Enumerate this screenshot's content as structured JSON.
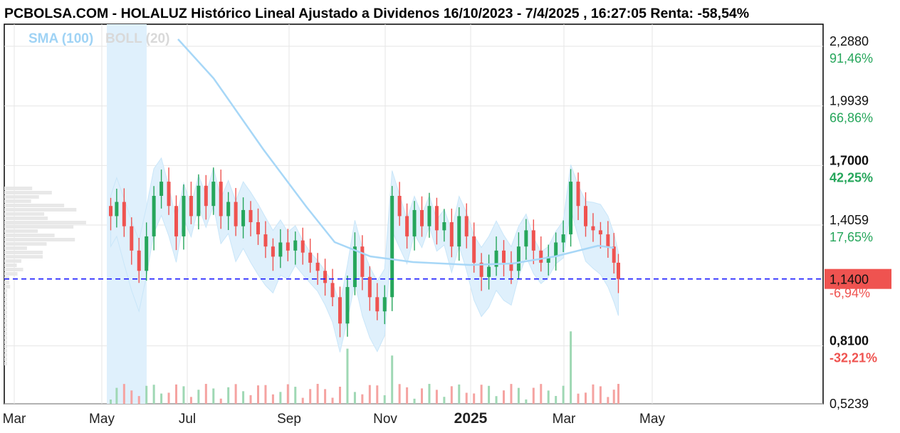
{
  "title": "PCBOLSA.COM - HOLALUZ Histórico Lineal Ajustado a Dividenos 16/10/2023 - 7/4/2025 , 16:27:05 Renta: -58,54%",
  "legend": {
    "sma": "SMA (100)",
    "boll": "BOLL (20)"
  },
  "colors": {
    "up": "#26a65b",
    "down": "#ef5350",
    "sma": "#a7d7f7",
    "band": "#dff0fc",
    "last": "#1a1aff",
    "label_bg": "#ef5350"
  },
  "chart_data": {
    "type": "candlestick",
    "title": "PCBOLSA.COM - HOLALUZ Histórico Lineal Ajustado a Dividenos 16/10/2023 - 7/4/2025 , 16:27:05 Renta: -58,54%",
    "x_ticks": [
      "Mar",
      "May",
      "Jul",
      "Sep",
      "Nov",
      "2025",
      "Mar",
      "May"
    ],
    "price_levels": [
      {
        "price": "2,2880",
        "pct": "91,46%",
        "bold": false,
        "pct_color": "#26a65b"
      },
      {
        "price": "1,9939",
        "pct": "66,86%",
        "bold": false,
        "pct_color": "#26a65b"
      },
      {
        "price": "1,7000",
        "pct": "42,25%",
        "bold": true,
        "pct_color": "#26a65b"
      },
      {
        "price": "1,4059",
        "pct": "17,65%",
        "bold": false,
        "pct_color": "#26a65b"
      },
      {
        "price": "0,8100",
        "pct": "-32,21%",
        "bold": true,
        "pct_color": "#ef5350"
      },
      {
        "price": "0,5239",
        "pct": "",
        "bold": false,
        "pct_color": "#ef5350"
      }
    ],
    "last_price": "1,1400",
    "last_pct": "-6,94%",
    "ylim": [
      0.5239,
      2.35
    ],
    "close_series": [
      {
        "date": "2024-05-01",
        "close": 1.45
      },
      {
        "date": "2024-05-05",
        "close": 1.52
      },
      {
        "date": "2024-05-10",
        "close": 1.4
      },
      {
        "date": "2024-05-15",
        "close": 1.28
      },
      {
        "date": "2024-05-20",
        "close": 1.18
      },
      {
        "date": "2024-05-25",
        "close": 1.35
      },
      {
        "date": "2024-05-30",
        "close": 1.55
      },
      {
        "date": "2024-06-04",
        "close": 1.62
      },
      {
        "date": "2024-06-09",
        "close": 1.5
      },
      {
        "date": "2024-06-14",
        "close": 1.35
      },
      {
        "date": "2024-06-19",
        "close": 1.55
      },
      {
        "date": "2024-06-24",
        "close": 1.45
      },
      {
        "date": "2024-06-29",
        "close": 1.6
      },
      {
        "date": "2024-07-04",
        "close": 1.5
      },
      {
        "date": "2024-07-09",
        "close": 1.62
      },
      {
        "date": "2024-07-14",
        "close": 1.45
      },
      {
        "date": "2024-07-19",
        "close": 1.52
      },
      {
        "date": "2024-07-24",
        "close": 1.4
      },
      {
        "date": "2024-07-29",
        "close": 1.48
      },
      {
        "date": "2024-08-03",
        "close": 1.42
      },
      {
        "date": "2024-08-08",
        "close": 1.36
      },
      {
        "date": "2024-08-13",
        "close": 1.3
      },
      {
        "date": "2024-08-18",
        "close": 1.25
      },
      {
        "date": "2024-08-23",
        "close": 1.32
      },
      {
        "date": "2024-08-28",
        "close": 1.28
      },
      {
        "date": "2024-09-02",
        "close": 1.33
      },
      {
        "date": "2024-09-07",
        "close": 1.27
      },
      {
        "date": "2024-09-12",
        "close": 1.22
      },
      {
        "date": "2024-09-17",
        "close": 1.18
      },
      {
        "date": "2024-09-22",
        "close": 1.12
      },
      {
        "date": "2024-09-27",
        "close": 1.05
      },
      {
        "date": "2024-10-02",
        "close": 0.92
      },
      {
        "date": "2024-10-07",
        "close": 1.1
      },
      {
        "date": "2024-10-12",
        "close": 1.3
      },
      {
        "date": "2024-10-17",
        "close": 1.15
      },
      {
        "date": "2024-10-22",
        "close": 1.05
      },
      {
        "date": "2024-10-27",
        "close": 0.98
      },
      {
        "date": "2024-11-01",
        "close": 1.05
      },
      {
        "date": "2024-11-06",
        "close": 1.55
      },
      {
        "date": "2024-11-11",
        "close": 1.45
      },
      {
        "date": "2024-11-16",
        "close": 1.35
      },
      {
        "date": "2024-11-21",
        "close": 1.48
      },
      {
        "date": "2024-11-26",
        "close": 1.4
      },
      {
        "date": "2024-12-01",
        "close": 1.5
      },
      {
        "date": "2024-12-06",
        "close": 1.38
      },
      {
        "date": "2024-12-11",
        "close": 1.42
      },
      {
        "date": "2024-12-16",
        "close": 1.3
      },
      {
        "date": "2024-12-21",
        "close": 1.45
      },
      {
        "date": "2024-12-26",
        "close": 1.35
      },
      {
        "date": "2024-12-31",
        "close": 1.22
      },
      {
        "date": "2025-01-05",
        "close": 1.15
      },
      {
        "date": "2025-01-10",
        "close": 1.2
      },
      {
        "date": "2025-01-15",
        "close": 1.28
      },
      {
        "date": "2025-01-20",
        "close": 1.22
      },
      {
        "date": "2025-01-25",
        "close": 1.18
      },
      {
        "date": "2025-01-30",
        "close": 1.3
      },
      {
        "date": "2025-02-04",
        "close": 1.38
      },
      {
        "date": "2025-02-09",
        "close": 1.28
      },
      {
        "date": "2025-02-14",
        "close": 1.22
      },
      {
        "date": "2025-02-19",
        "close": 1.25
      },
      {
        "date": "2025-02-24",
        "close": 1.32
      },
      {
        "date": "2025-03-01",
        "close": 1.36
      },
      {
        "date": "2025-03-06",
        "close": 1.62
      },
      {
        "date": "2025-03-11",
        "close": 1.5
      },
      {
        "date": "2025-03-16",
        "close": 1.4
      },
      {
        "date": "2025-03-21",
        "close": 1.38
      },
      {
        "date": "2025-03-26",
        "close": 1.36
      },
      {
        "date": "2025-03-31",
        "close": 1.3
      },
      {
        "date": "2025-04-04",
        "close": 1.22
      },
      {
        "date": "2025-04-07",
        "close": 1.14
      }
    ]
  }
}
